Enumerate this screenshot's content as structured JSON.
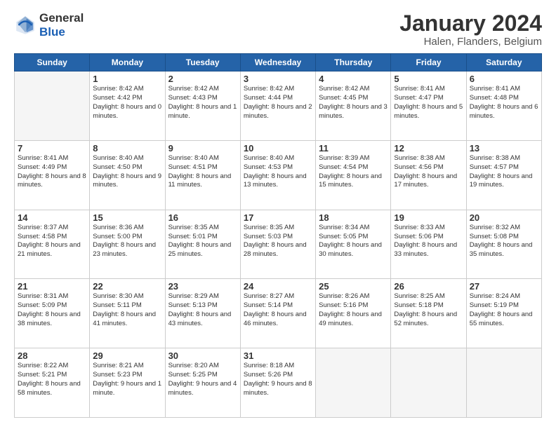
{
  "logo": {
    "general": "General",
    "blue": "Blue"
  },
  "header": {
    "month": "January 2024",
    "location": "Halen, Flanders, Belgium"
  },
  "weekdays": [
    "Sunday",
    "Monday",
    "Tuesday",
    "Wednesday",
    "Thursday",
    "Friday",
    "Saturday"
  ],
  "weeks": [
    [
      {
        "day": "",
        "empty": true
      },
      {
        "day": "1",
        "sunrise": "Sunrise: 8:42 AM",
        "sunset": "Sunset: 4:42 PM",
        "daylight": "Daylight: 8 hours and 0 minutes."
      },
      {
        "day": "2",
        "sunrise": "Sunrise: 8:42 AM",
        "sunset": "Sunset: 4:43 PM",
        "daylight": "Daylight: 8 hours and 1 minute."
      },
      {
        "day": "3",
        "sunrise": "Sunrise: 8:42 AM",
        "sunset": "Sunset: 4:44 PM",
        "daylight": "Daylight: 8 hours and 2 minutes."
      },
      {
        "day": "4",
        "sunrise": "Sunrise: 8:42 AM",
        "sunset": "Sunset: 4:45 PM",
        "daylight": "Daylight: 8 hours and 3 minutes."
      },
      {
        "day": "5",
        "sunrise": "Sunrise: 8:41 AM",
        "sunset": "Sunset: 4:47 PM",
        "daylight": "Daylight: 8 hours and 5 minutes."
      },
      {
        "day": "6",
        "sunrise": "Sunrise: 8:41 AM",
        "sunset": "Sunset: 4:48 PM",
        "daylight": "Daylight: 8 hours and 6 minutes."
      }
    ],
    [
      {
        "day": "7",
        "sunrise": "Sunrise: 8:41 AM",
        "sunset": "Sunset: 4:49 PM",
        "daylight": "Daylight: 8 hours and 8 minutes."
      },
      {
        "day": "8",
        "sunrise": "Sunrise: 8:40 AM",
        "sunset": "Sunset: 4:50 PM",
        "daylight": "Daylight: 8 hours and 9 minutes."
      },
      {
        "day": "9",
        "sunrise": "Sunrise: 8:40 AM",
        "sunset": "Sunset: 4:51 PM",
        "daylight": "Daylight: 8 hours and 11 minutes."
      },
      {
        "day": "10",
        "sunrise": "Sunrise: 8:40 AM",
        "sunset": "Sunset: 4:53 PM",
        "daylight": "Daylight: 8 hours and 13 minutes."
      },
      {
        "day": "11",
        "sunrise": "Sunrise: 8:39 AM",
        "sunset": "Sunset: 4:54 PM",
        "daylight": "Daylight: 8 hours and 15 minutes."
      },
      {
        "day": "12",
        "sunrise": "Sunrise: 8:38 AM",
        "sunset": "Sunset: 4:56 PM",
        "daylight": "Daylight: 8 hours and 17 minutes."
      },
      {
        "day": "13",
        "sunrise": "Sunrise: 8:38 AM",
        "sunset": "Sunset: 4:57 PM",
        "daylight": "Daylight: 8 hours and 19 minutes."
      }
    ],
    [
      {
        "day": "14",
        "sunrise": "Sunrise: 8:37 AM",
        "sunset": "Sunset: 4:58 PM",
        "daylight": "Daylight: 8 hours and 21 minutes."
      },
      {
        "day": "15",
        "sunrise": "Sunrise: 8:36 AM",
        "sunset": "Sunset: 5:00 PM",
        "daylight": "Daylight: 8 hours and 23 minutes."
      },
      {
        "day": "16",
        "sunrise": "Sunrise: 8:35 AM",
        "sunset": "Sunset: 5:01 PM",
        "daylight": "Daylight: 8 hours and 25 minutes."
      },
      {
        "day": "17",
        "sunrise": "Sunrise: 8:35 AM",
        "sunset": "Sunset: 5:03 PM",
        "daylight": "Daylight: 8 hours and 28 minutes."
      },
      {
        "day": "18",
        "sunrise": "Sunrise: 8:34 AM",
        "sunset": "Sunset: 5:05 PM",
        "daylight": "Daylight: 8 hours and 30 minutes."
      },
      {
        "day": "19",
        "sunrise": "Sunrise: 8:33 AM",
        "sunset": "Sunset: 5:06 PM",
        "daylight": "Daylight: 8 hours and 33 minutes."
      },
      {
        "day": "20",
        "sunrise": "Sunrise: 8:32 AM",
        "sunset": "Sunset: 5:08 PM",
        "daylight": "Daylight: 8 hours and 35 minutes."
      }
    ],
    [
      {
        "day": "21",
        "sunrise": "Sunrise: 8:31 AM",
        "sunset": "Sunset: 5:09 PM",
        "daylight": "Daylight: 8 hours and 38 minutes."
      },
      {
        "day": "22",
        "sunrise": "Sunrise: 8:30 AM",
        "sunset": "Sunset: 5:11 PM",
        "daylight": "Daylight: 8 hours and 41 minutes."
      },
      {
        "day": "23",
        "sunrise": "Sunrise: 8:29 AM",
        "sunset": "Sunset: 5:13 PM",
        "daylight": "Daylight: 8 hours and 43 minutes."
      },
      {
        "day": "24",
        "sunrise": "Sunrise: 8:27 AM",
        "sunset": "Sunset: 5:14 PM",
        "daylight": "Daylight: 8 hours and 46 minutes."
      },
      {
        "day": "25",
        "sunrise": "Sunrise: 8:26 AM",
        "sunset": "Sunset: 5:16 PM",
        "daylight": "Daylight: 8 hours and 49 minutes."
      },
      {
        "day": "26",
        "sunrise": "Sunrise: 8:25 AM",
        "sunset": "Sunset: 5:18 PM",
        "daylight": "Daylight: 8 hours and 52 minutes."
      },
      {
        "day": "27",
        "sunrise": "Sunrise: 8:24 AM",
        "sunset": "Sunset: 5:19 PM",
        "daylight": "Daylight: 8 hours and 55 minutes."
      }
    ],
    [
      {
        "day": "28",
        "sunrise": "Sunrise: 8:22 AM",
        "sunset": "Sunset: 5:21 PM",
        "daylight": "Daylight: 8 hours and 58 minutes."
      },
      {
        "day": "29",
        "sunrise": "Sunrise: 8:21 AM",
        "sunset": "Sunset: 5:23 PM",
        "daylight": "Daylight: 9 hours and 1 minute."
      },
      {
        "day": "30",
        "sunrise": "Sunrise: 8:20 AM",
        "sunset": "Sunset: 5:25 PM",
        "daylight": "Daylight: 9 hours and 4 minutes."
      },
      {
        "day": "31",
        "sunrise": "Sunrise: 8:18 AM",
        "sunset": "Sunset: 5:26 PM",
        "daylight": "Daylight: 9 hours and 8 minutes."
      },
      {
        "day": "",
        "empty": true
      },
      {
        "day": "",
        "empty": true
      },
      {
        "day": "",
        "empty": true
      }
    ]
  ]
}
